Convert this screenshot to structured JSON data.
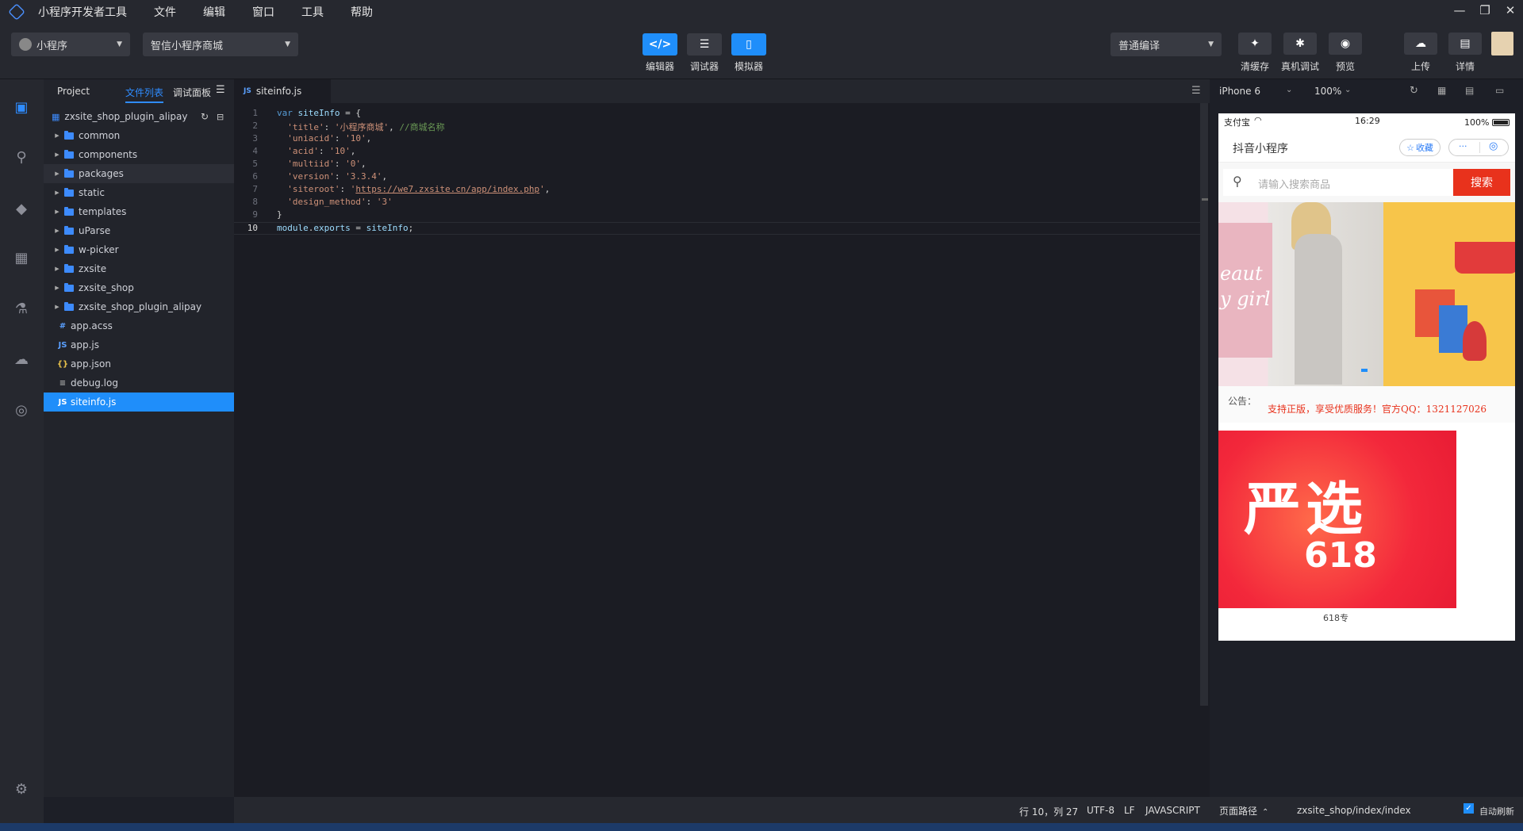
{
  "window": {
    "title": "小程序开发者工具",
    "menus": [
      "文件",
      "编辑",
      "窗口",
      "工具",
      "帮助"
    ],
    "controls": [
      "—",
      "❐",
      "✕"
    ]
  },
  "toolbar": {
    "app_type": "小程序",
    "project": "智信小程序商城",
    "modes": [
      {
        "label": "编辑器",
        "icon": "</>"
      },
      {
        "label": "调试器",
        "icon": "☰"
      },
      {
        "label": "模拟器",
        "icon": "▯"
      }
    ],
    "compile_mode": "普通编译",
    "actions": [
      {
        "label": "清缓存"
      },
      {
        "label": "真机调试"
      },
      {
        "label": "预览"
      },
      {
        "label": "上传"
      },
      {
        "label": "详情"
      }
    ],
    "accent": "#1f8efa"
  },
  "explorer": {
    "tabs": [
      "Project",
      "文件列表",
      "调试面板"
    ],
    "root": "zxsite_shop_plugin_alipay",
    "folders": [
      "common",
      "components",
      "packages",
      "static",
      "templates",
      "uParse",
      "w-picker",
      "zxsite",
      "zxsite_shop",
      "zxsite_shop_plugin_alipay"
    ],
    "files": [
      {
        "name": "app.acss",
        "icon": "#"
      },
      {
        "name": "app.js",
        "icon": "JS"
      },
      {
        "name": "app.json",
        "icon": "{}"
      },
      {
        "name": "debug.log",
        "icon": "≡"
      },
      {
        "name": "siteinfo.js",
        "icon": "JS"
      }
    ],
    "selected": "siteinfo.js"
  },
  "editor": {
    "tab_icon": "JS",
    "tab": "siteinfo.js",
    "line_numbers": [
      "1",
      "2",
      "3",
      "4",
      "5",
      "6",
      "7",
      "8",
      "9",
      "10"
    ],
    "lines": [
      "var siteInfo = {",
      "  'title': '小程序商城', //商城名称",
      "  'uniacid': '10',",
      "  'acid': '10',",
      "  'multiid': '0',",
      "  'version': '3.3.4',",
      "  'siteroot': 'https://we7.zxsite.cn/app/index.php',",
      "  'design_method': '3'",
      "}",
      "module.exports = siteInfo;"
    ]
  },
  "simulator": {
    "device": "iPhone 6",
    "zoom": "100%",
    "carrier": "支付宝",
    "time": "16:29",
    "battery": "100%",
    "app_name": "抖音小程序",
    "favorite": "收藏",
    "more": "···",
    "search_placeholder": "请输入搜索商品",
    "search_button": "搜索",
    "banner_text": "eauty girl",
    "notice_label": "公告：",
    "notice_text": "支持正版，享受优质服务！官方QQ：1321127026",
    "promo_title": "严选",
    "promo_number": "618",
    "promo_caption": "618专",
    "search_color": "#e8321c"
  },
  "status": {
    "position": "行 10，列 27",
    "encoding": "UTF-8",
    "eol": "LF",
    "language": "JAVASCRIPT",
    "page_path_label": "页面路径",
    "page_path": "zxsite_shop/index/index",
    "auto_refresh": "自动刷新"
  }
}
